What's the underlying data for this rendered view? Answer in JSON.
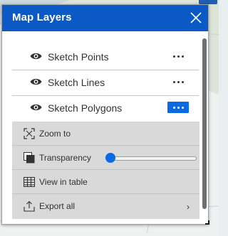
{
  "panel": {
    "title": "Map Layers",
    "accent_color": "#0a59c4"
  },
  "layers": [
    {
      "label": "Sketch Points",
      "menu_open": false
    },
    {
      "label": "Sketch Lines",
      "menu_open": false
    },
    {
      "label": "Sketch Polygons",
      "menu_open": true
    }
  ],
  "actions": {
    "zoom_to": "Zoom to",
    "transparency": "Transparency",
    "transparency_value": 0,
    "view_in_table": "View in table",
    "export_all": "Export all",
    "export_chevron": "›"
  },
  "icons": [
    "close-icon",
    "eye-icon",
    "more-options-icon",
    "zoom-to-icon",
    "transparency-icon",
    "table-icon",
    "export-icon",
    "chevron-right-icon"
  ]
}
